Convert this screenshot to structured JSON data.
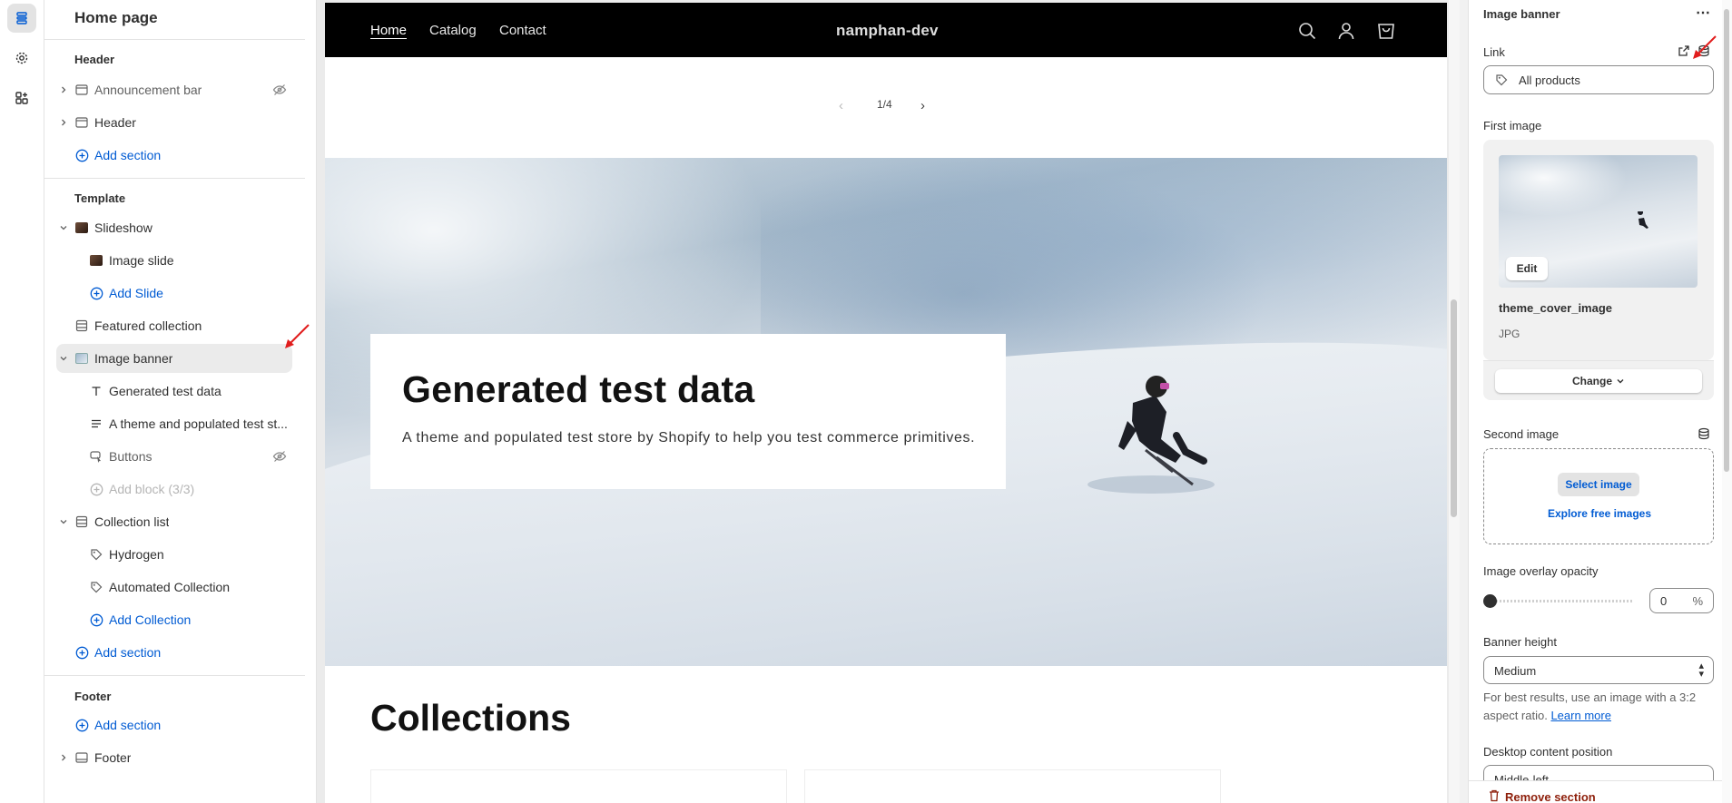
{
  "sidebar": {
    "title": "Home page",
    "header_group": "Header",
    "header_items": [
      {
        "label": "Announcement bar"
      },
      {
        "label": "Header"
      }
    ],
    "add_section": "Add section",
    "template_group": "Template",
    "slideshow": "Slideshow",
    "image_slide": "Image slide",
    "add_slide": "Add Slide",
    "featured_collection": "Featured collection",
    "image_banner": "Image banner",
    "generated_test_data": "Generated test data",
    "theme_text": "A theme and populated test st...",
    "buttons": "Buttons",
    "add_block": "Add block (3/3)",
    "collection_list": "Collection list",
    "hydrogen": "Hydrogen",
    "automated_collection": "Automated Collection",
    "add_collection": "Add Collection",
    "add_section_2": "Add section",
    "footer_group": "Footer",
    "add_section_3": "Add section",
    "footer_item": "Footer"
  },
  "preview": {
    "nav": {
      "home": "Home",
      "catalog": "Catalog",
      "contact": "Contact",
      "brand": "namphan-dev"
    },
    "pager": {
      "prev": "‹",
      "counter": "1/4",
      "next": "›"
    },
    "banner": {
      "heading": "Generated test data",
      "text": "A theme and populated test store by Shopify to help you test commerce primitives."
    },
    "collections_heading": "Collections"
  },
  "settings": {
    "title": "Image banner",
    "more": "⋯",
    "link_label": "Link",
    "link_value": "All products",
    "first_image_label": "First image",
    "edit": "Edit",
    "image_name": "theme_cover_image",
    "image_ext": "JPG",
    "change": "Change",
    "second_image_label": "Second image",
    "select_image": "Select image",
    "explore": "Explore free images",
    "overlay_label": "Image overlay opacity",
    "overlay_value": "0",
    "overlay_unit": "%",
    "overlay_fraction": 0,
    "banner_height_label": "Banner height",
    "banner_height_value": "Medium",
    "help_text": "For best results, use an image with a 3:2 aspect ratio.",
    "learn_more": "Learn more",
    "desktop_position_label": "Desktop content position",
    "desktop_position_value": "Middle-left",
    "remove_section": "Remove section"
  },
  "colors": {
    "accent_link": "#005bd3",
    "nav_bg": "#000000",
    "annotation_arrow": "#e11d1d",
    "danger": "#8e1f0b"
  }
}
